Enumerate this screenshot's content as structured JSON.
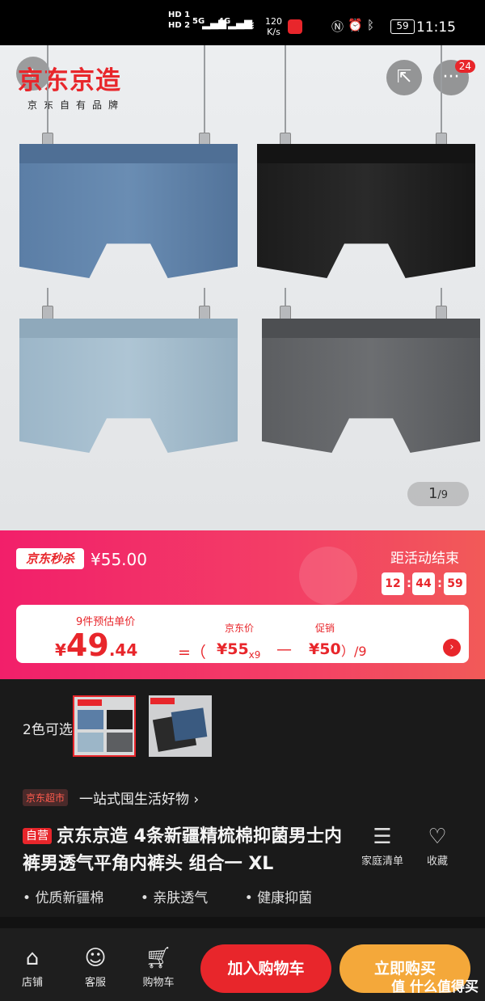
{
  "status_bar": {
    "hd1": "HD 1",
    "hd2": "HD 2",
    "net1": "5G",
    "net2": "4G",
    "speed": "120",
    "speed_unit": "K/s",
    "battery": "59",
    "time": "11:15"
  },
  "hero": {
    "brand_logo": "京东京造",
    "brand_sub": "京东自有品牌",
    "share_icon": "share-icon",
    "more_icon": "more-icon",
    "more_badge": "24",
    "pager_current": "1",
    "pager_total": "/9"
  },
  "promo": {
    "seckill_tag": "京东秒杀",
    "original_price": "¥55.00",
    "countdown_label": "距活动结束",
    "countdown": [
      "12",
      "44",
      "59"
    ],
    "unit_label": "9件预估单价",
    "price_yen": "¥",
    "price_int": "49",
    "price_dec": ".44",
    "formula_eq": "=（",
    "jd_price_label": "京东价",
    "jd_price": "¥55",
    "jd_price_mult": "x9",
    "minus": "—",
    "promo_label": "促销",
    "promo_value": "¥50",
    "divisor": "）/9"
  },
  "variants": {
    "label": "2色可选"
  },
  "store": {
    "tag": "京东超市",
    "slogan": "一站式囤生活好物 ›"
  },
  "product": {
    "self_tag": "自营",
    "title": "京东京造 4条新疆精梳棉抑菌男士内裤男透气平角内裤头 组合一 XL",
    "family_list": "家庭清单",
    "favorite": "收藏",
    "bullets": [
      "优质新疆棉",
      "亲肤透气",
      "健康抑菌"
    ]
  },
  "bottom_bar": {
    "shop": "店铺",
    "service": "客服",
    "cart": "购物车",
    "add_to_cart": "加入购物车",
    "buy_now": "立即购买"
  },
  "watermark": "值 什么值得买",
  "colors": {
    "accent": "#e8262b",
    "promo_start": "#f21f6a",
    "buy_button": "#f4a83a"
  }
}
